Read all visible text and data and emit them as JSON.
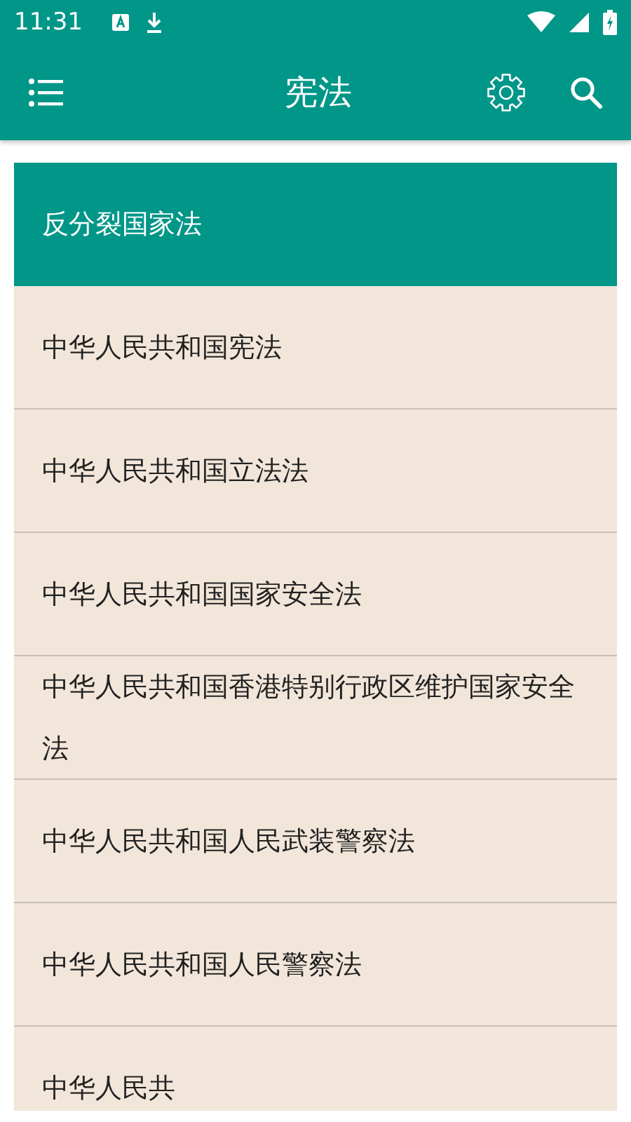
{
  "status_bar": {
    "time": "11:31"
  },
  "app_bar": {
    "title": "宪法"
  },
  "laws": [
    {
      "title": "反分裂国家法",
      "selected": true
    },
    {
      "title": "中华人民共和国宪法",
      "selected": false
    },
    {
      "title": "中华人民共和国立法法",
      "selected": false
    },
    {
      "title": "中华人民共和国国家安全法",
      "selected": false
    },
    {
      "title": "中华人民共和国香港特别行政区维护国家安全法",
      "selected": false
    },
    {
      "title": "中华人民共和国人民武装警察法",
      "selected": false
    },
    {
      "title": "中华人民共和国人民警察法",
      "selected": false
    },
    {
      "title": "中华人民共",
      "selected": false
    }
  ]
}
